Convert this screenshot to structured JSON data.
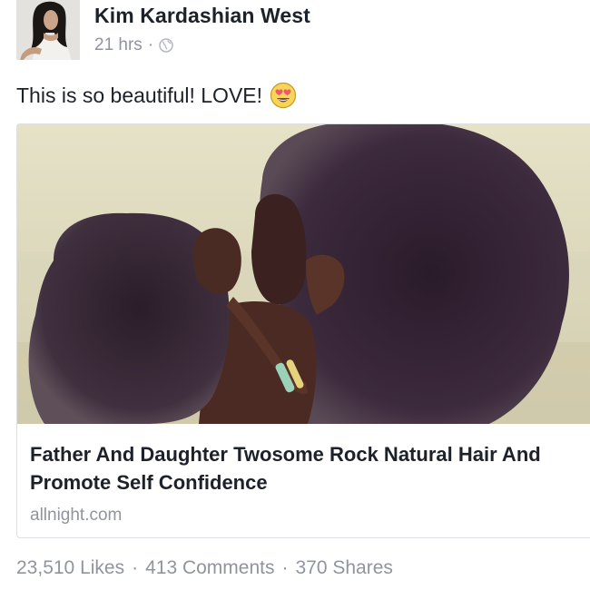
{
  "post": {
    "author": "Kim Kardashian West",
    "time": "21 hrs",
    "separator": "·",
    "privacy_icon": "globe-icon",
    "text": "This is so beautiful! LOVE!",
    "emoji": "heart-eyes-emoji"
  },
  "link_card": {
    "title": "Father And Daughter Twosome Rock Natural Hair And Promote Self Confidence",
    "domain": "allnight.com"
  },
  "stats": {
    "likes": "23,510 Likes",
    "comments": "413 Comments",
    "shares": "370 Shares",
    "separator": "·"
  },
  "colors": {
    "text_primary": "#1d2129",
    "text_secondary": "#90949c",
    "card_border": "#dddfe2"
  }
}
